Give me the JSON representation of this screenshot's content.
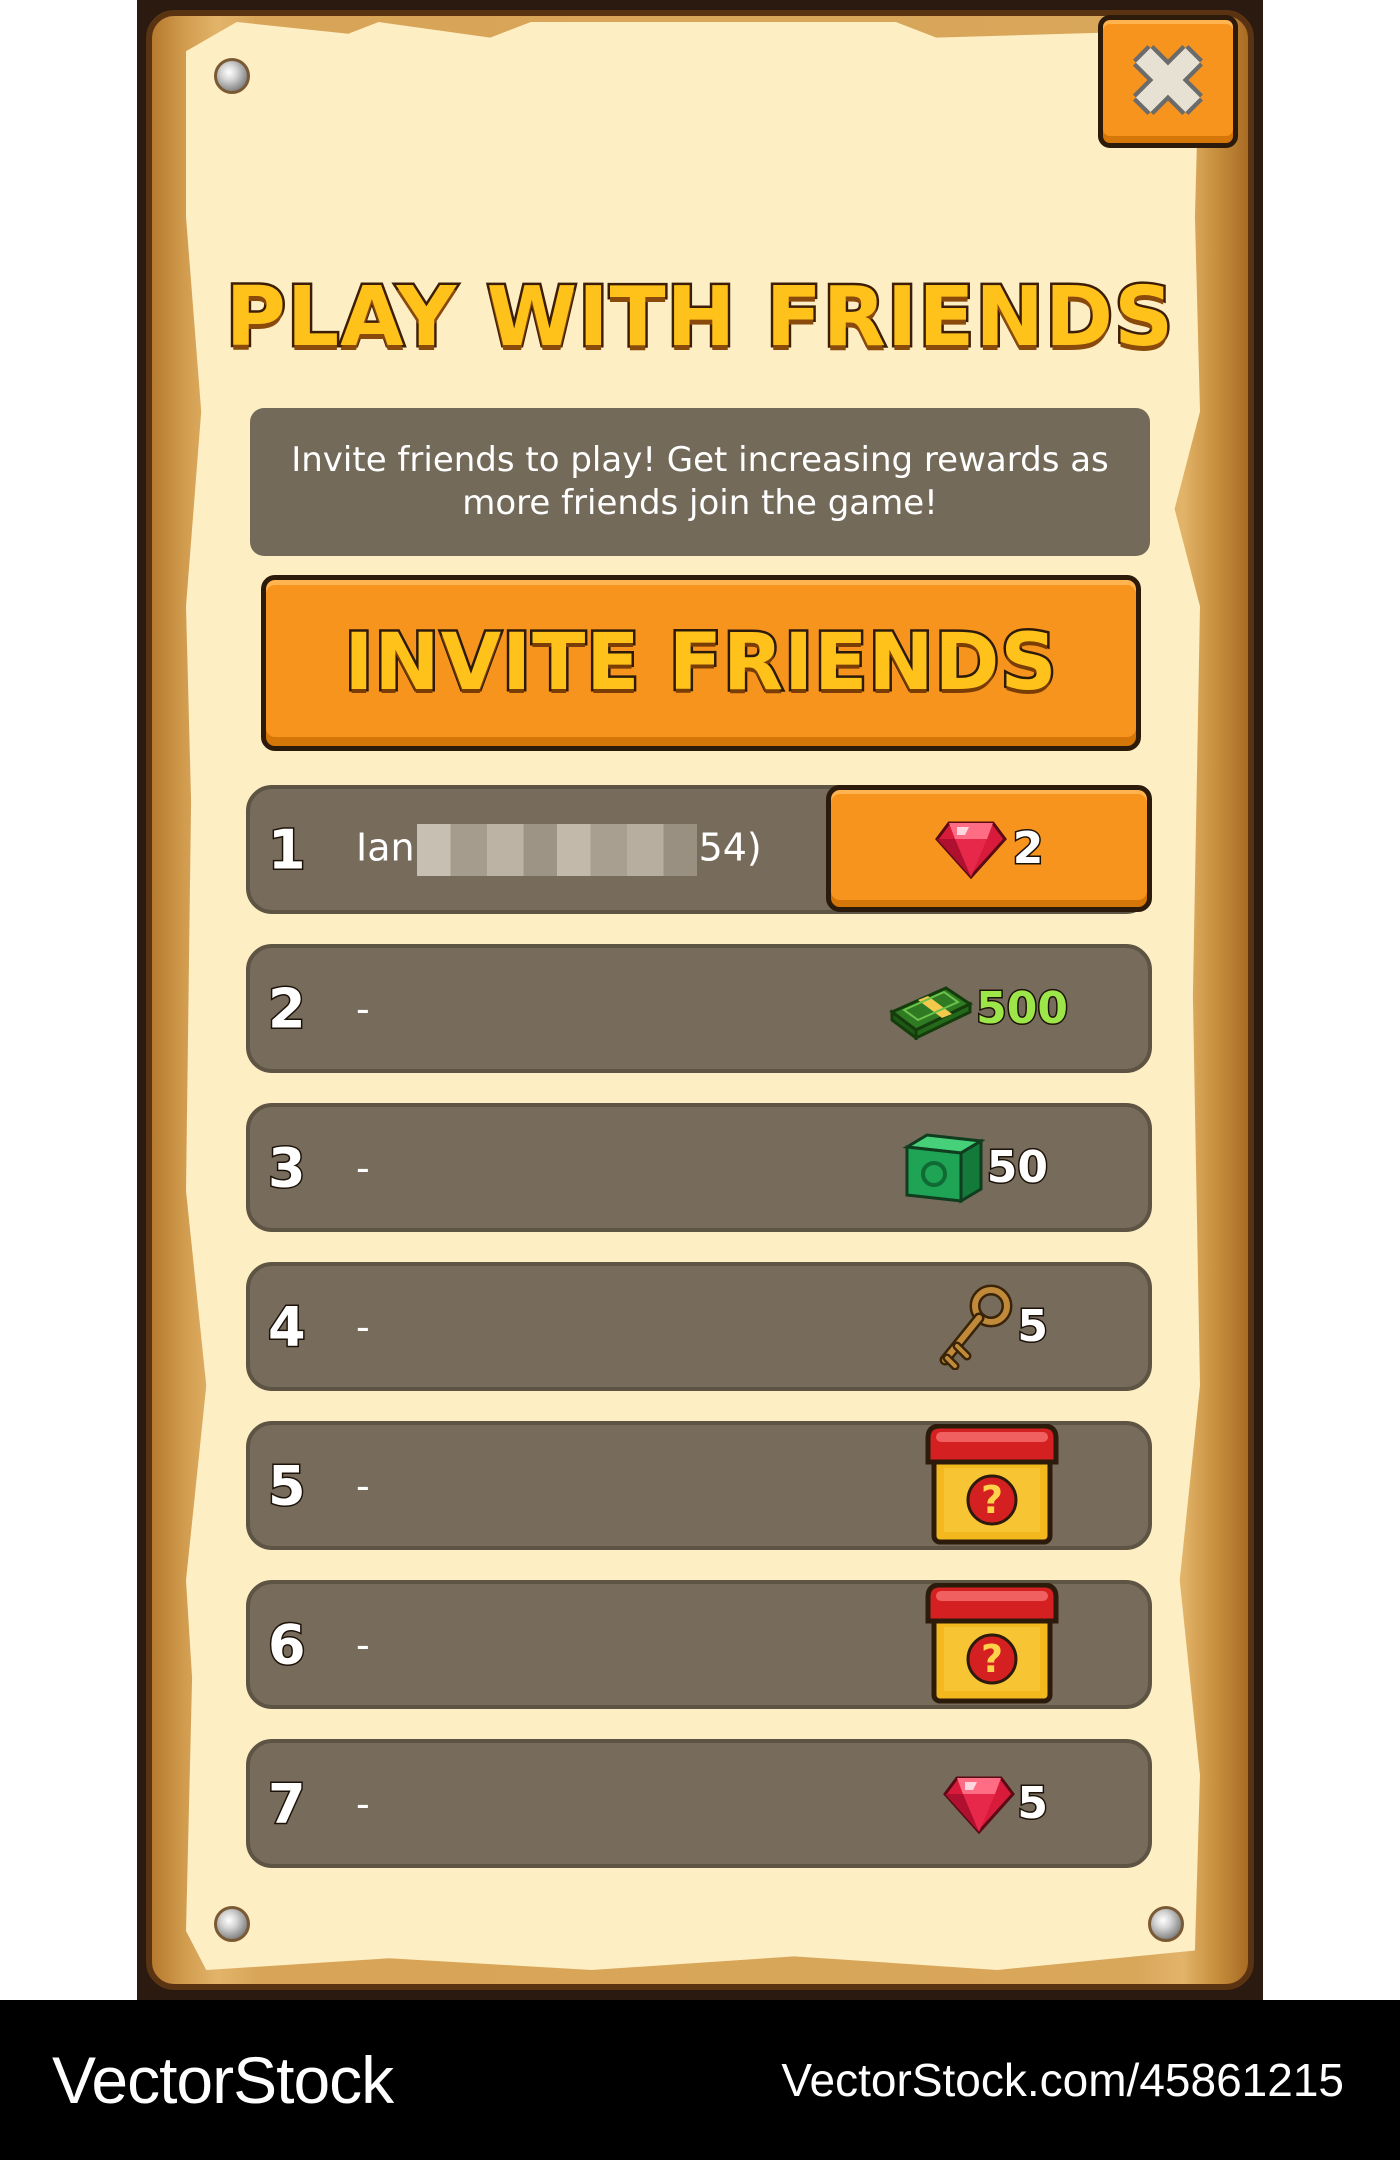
{
  "dialog": {
    "title": "PLAY WITH FRIENDS",
    "description": "Invite friends to play! Get increasing rewards as more friends join the game!",
    "invite_button": "INVITE FRIENDS",
    "close_icon": "close-icon",
    "colors": {
      "button_orange": "#f7941d",
      "title_yellow": "#ffc21a",
      "row_bg": "#776c5c",
      "parchment": "#fdeec4"
    }
  },
  "rewards": [
    {
      "rank": "1",
      "name_prefix": "Ian",
      "name_suffix": "54)",
      "name_redacted": true,
      "reward_icon": "gem-icon",
      "amount": "2",
      "claimable": true
    },
    {
      "rank": "2",
      "name": "-",
      "reward_icon": "cash-icon",
      "amount": "500"
    },
    {
      "rank": "3",
      "name": "-",
      "reward_icon": "emerald-cube-icon",
      "amount": "50"
    },
    {
      "rank": "4",
      "name": "-",
      "reward_icon": "key-icon",
      "amount": "5"
    },
    {
      "rank": "5",
      "name": "-",
      "reward_icon": "mystery-chest-icon",
      "amount": ""
    },
    {
      "rank": "6",
      "name": "-",
      "reward_icon": "mystery-chest-icon",
      "amount": ""
    },
    {
      "rank": "7",
      "name": "-",
      "reward_icon": "gem-icon",
      "amount": "5"
    }
  ],
  "footer": {
    "brand": "VectorStock",
    "url": "VectorStock.com/45861215"
  }
}
